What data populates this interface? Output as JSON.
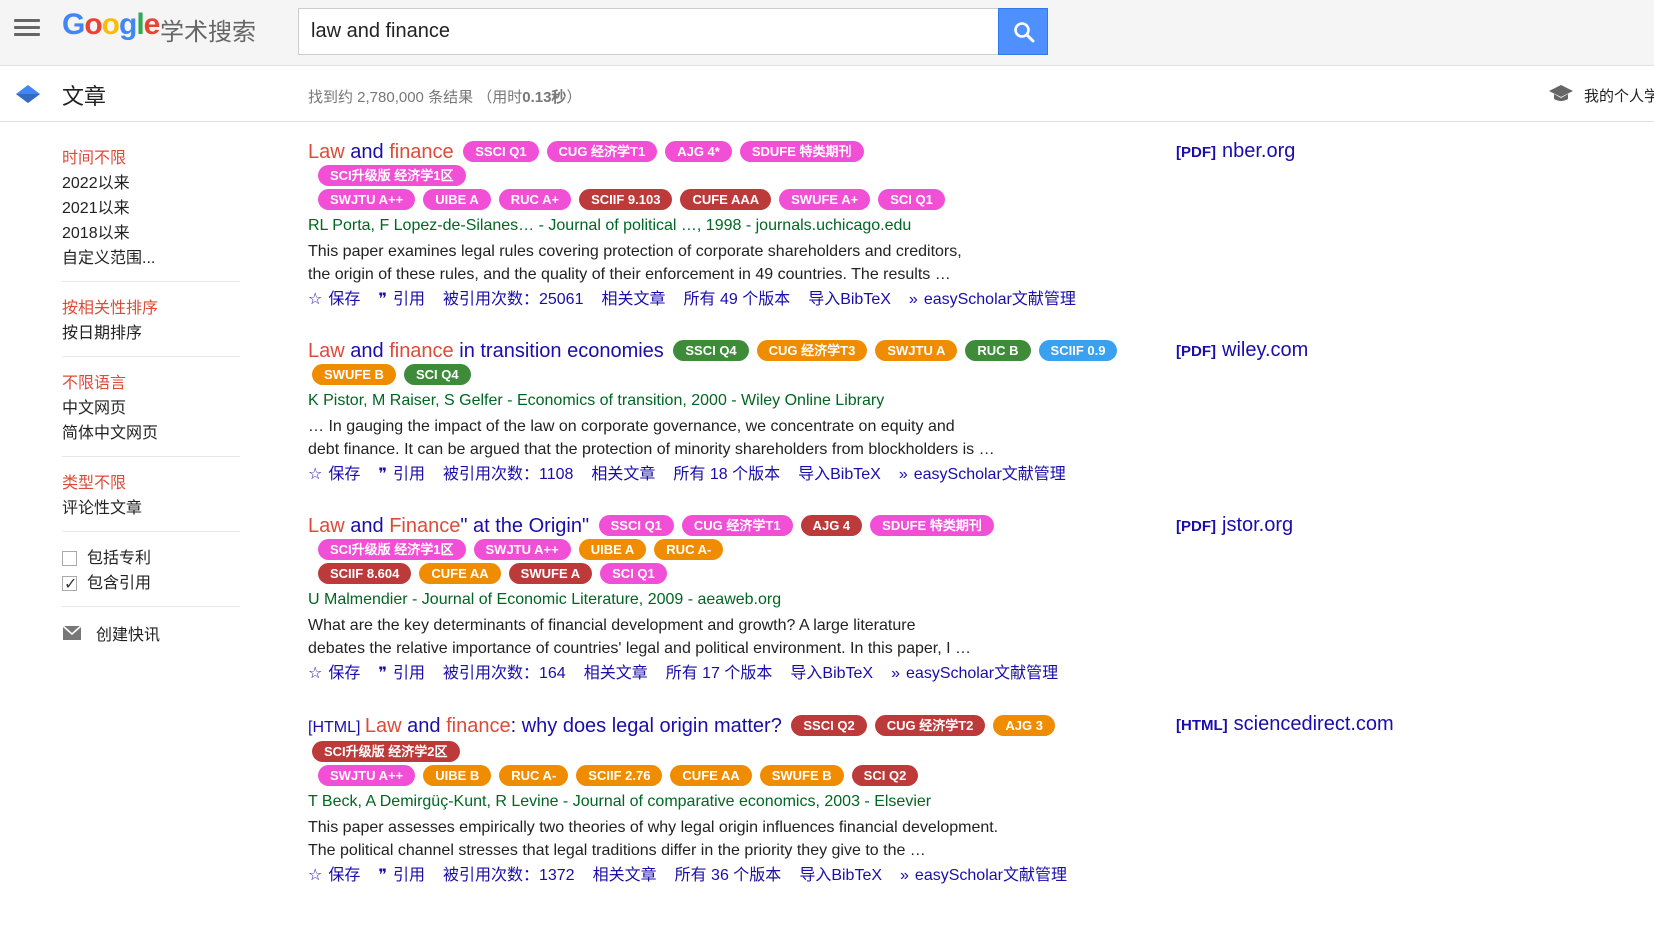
{
  "header": {
    "logo_text": "Google",
    "logo_sub": "学术搜索",
    "search_value": "law and finance"
  },
  "subbar": {
    "section_title": "文章",
    "result_count_prefix": "找到约 2,780,000 条结果 （用时",
    "result_time": "0.13秒",
    "result_count_suffix": "）",
    "mylib_label": "我的个人学术档案"
  },
  "sidebar": {
    "time": [
      "时间不限",
      "2022以来",
      "2021以来",
      "2018以来",
      "自定义范围..."
    ],
    "sort": [
      "按相关性排序",
      "按日期排序"
    ],
    "lang": [
      "不限语言",
      "中文网页",
      "简体中文网页"
    ],
    "type": [
      "类型不限",
      "评论性文章"
    ],
    "checks": [
      {
        "label": "包括专利",
        "checked": false
      },
      {
        "label": "包含引用",
        "checked": true
      }
    ],
    "alert_label": "创建快讯"
  },
  "colors": {
    "pink": "#f14fd6",
    "red": "#bd3a3a",
    "orange": "#f08c00",
    "green": "#3e8c3a",
    "blue": "#3aa0f0"
  },
  "results": [
    {
      "prefix": "",
      "title_parts": [
        [
          "Law",
          true
        ],
        [
          " and ",
          false
        ],
        [
          "finance",
          true
        ]
      ],
      "badges": [
        [
          [
            "SSCI Q1",
            "pink"
          ],
          [
            "CUG 经济学T1",
            "pink"
          ],
          [
            "AJG 4*",
            "pink"
          ],
          [
            "SDUFE 特类期刊",
            "pink"
          ]
        ],
        [
          [
            "SCI升级版 经济学1区",
            "pink"
          ]
        ],
        [
          [
            "SWJTU A++",
            "pink"
          ],
          [
            "UIBE A",
            "pink"
          ],
          [
            "RUC A+",
            "pink"
          ],
          [
            "SCIIF 9.103",
            "red"
          ],
          [
            "CUFE AAA",
            "red"
          ],
          [
            "SWUFE A+",
            "pink"
          ],
          [
            "SCI Q1",
            "pink"
          ]
        ]
      ],
      "authors": "RL Porta, F Lopez-de-Silanes… - Journal of political …, 1998 - journals.uchicago.edu",
      "snippet1": "This paper examines legal rules covering protection of corporate shareholders and creditors,",
      "snippet2": "the origin of these rules, and the quality of their enforcement in 49 countries. The results …",
      "actions": [
        "保存",
        "引用",
        "被引用次数：25061",
        "相关文章",
        "所有 49 个版本",
        "导入BibTeX",
        "easyScholar文献管理"
      ],
      "side_tag": "[PDF]",
      "side_domain": "nber.org"
    },
    {
      "prefix": "",
      "title_parts": [
        [
          "Law",
          true
        ],
        [
          " and ",
          false
        ],
        [
          "finance",
          true
        ],
        [
          " in transition economies",
          false
        ]
      ],
      "badges": [
        [
          [
            "SSCI Q4",
            "green"
          ],
          [
            "CUG 经济学T3",
            "orange"
          ],
          [
            "SWJTU A",
            "orange"
          ],
          [
            "RUC B",
            "green"
          ],
          [
            "SCIIF 0.9",
            "blue"
          ],
          [
            "SWUFE B",
            "orange"
          ],
          [
            "SCI Q4",
            "green"
          ]
        ]
      ],
      "authors": "K Pistor, M Raiser, S Gelfer - Economics of transition, 2000 - Wiley Online Library",
      "snippet1": "… In gauging the impact of the law on corporate governance, we concentrate on equity and",
      "snippet2": "debt finance. It can be argued that the protection of minority shareholders from blockholders is …",
      "actions": [
        "保存",
        "引用",
        "被引用次数：1108",
        "相关文章",
        "所有 18 个版本",
        "导入BibTeX",
        "easyScholar文献管理"
      ],
      "side_tag": "[PDF]",
      "side_domain": "wiley.com"
    },
    {
      "prefix": "",
      "title_parts": [
        [
          "Law",
          true
        ],
        [
          " and ",
          false
        ],
        [
          "Finance",
          true
        ],
        [
          "\" at the Origin\"",
          false
        ]
      ],
      "badges": [
        [
          [
            "SSCI Q1",
            "pink"
          ],
          [
            "CUG 经济学T1",
            "pink"
          ],
          [
            "AJG 4",
            "red"
          ],
          [
            "SDUFE 特类期刊",
            "pink"
          ]
        ],
        [
          [
            "SCI升级版 经济学1区",
            "pink"
          ],
          [
            "SWJTU A++",
            "pink"
          ],
          [
            "UIBE A",
            "orange"
          ],
          [
            "RUC A-",
            "orange"
          ]
        ],
        [
          [
            "SCIIF 8.604",
            "red"
          ],
          [
            "CUFE AA",
            "orange"
          ],
          [
            "SWUFE A",
            "red"
          ],
          [
            "SCI Q1",
            "pink"
          ]
        ]
      ],
      "authors": "U Malmendier - Journal of Economic Literature, 2009 - aeaweb.org",
      "snippet1": "What are the key determinants of financial development and growth? A large literature",
      "snippet2": "debates the relative importance of countries' legal and political environment. In this paper, I …",
      "actions": [
        "保存",
        "引用",
        "被引用次数：164",
        "相关文章",
        "所有 17 个版本",
        "导入BibTeX",
        "easyScholar文献管理"
      ],
      "side_tag": "[PDF]",
      "side_domain": "jstor.org"
    },
    {
      "prefix": "[HTML] ",
      "title_parts": [
        [
          "Law",
          true
        ],
        [
          " and ",
          false
        ],
        [
          "finance",
          true
        ],
        [
          ": why does legal origin matter?",
          false
        ]
      ],
      "badges": [
        [
          [
            "SSCI Q2",
            "red"
          ],
          [
            "CUG 经济学T2",
            "red"
          ],
          [
            "AJG 3",
            "orange"
          ],
          [
            "SCI升级版 经济学2区",
            "red"
          ]
        ],
        [
          [
            "SWJTU A++",
            "pink"
          ],
          [
            "UIBE B",
            "orange"
          ],
          [
            "RUC A-",
            "orange"
          ],
          [
            "SCIIF 2.76",
            "orange"
          ],
          [
            "CUFE AA",
            "orange"
          ],
          [
            "SWUFE B",
            "orange"
          ],
          [
            "SCI Q2",
            "red"
          ]
        ]
      ],
      "authors": "T Beck, A Demirgüç-Kunt, R Levine - Journal of comparative economics, 2003 - Elsevier",
      "snippet1": "This paper assesses empirically two theories of why legal origin influences financial development.",
      "snippet2": "The political channel stresses that legal traditions differ in the priority they give to the …",
      "actions": [
        "保存",
        "引用",
        "被引用次数：1372",
        "相关文章",
        "所有 36 个版本",
        "导入BibTeX",
        "easyScholar文献管理"
      ],
      "side_tag": "[HTML]",
      "side_domain": "sciencedirect.com"
    }
  ]
}
